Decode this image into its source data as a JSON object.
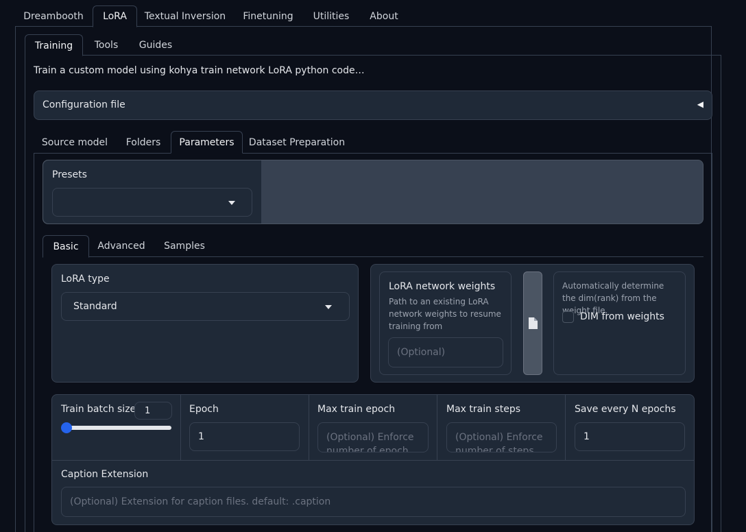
{
  "top_tabs": [
    "Dreambooth",
    "LoRA",
    "Textual Inversion",
    "Finetuning",
    "Utilities",
    "About"
  ],
  "sub_tabs": [
    "Training",
    "Tools",
    "Guides"
  ],
  "description": "Train a custom model using kohya train network LoRA python code…",
  "config_accordion": {
    "label": "Configuration file",
    "arrow": "◀"
  },
  "section_tabs": [
    "Source model",
    "Folders",
    "Parameters",
    "Dataset Preparation"
  ],
  "presets": {
    "label": "Presets",
    "value": ""
  },
  "param_tabs": [
    "Basic",
    "Advanced",
    "Samples"
  ],
  "lora_type": {
    "label": "LoRA type",
    "value": "Standard"
  },
  "network_weights": {
    "label": "LoRA network weights",
    "info": "Path to an existing LoRA network weights to resume training from",
    "placeholder": "(Optional)",
    "file_icon": "file-icon"
  },
  "dim_from_weights": {
    "info": "Automatically determine the dim(rank) from the weight file.",
    "label": "DIM from weights",
    "checked": false
  },
  "train_batch_size": {
    "label": "Train batch size",
    "value": "1",
    "slider_fraction": 0.0
  },
  "epoch": {
    "label": "Epoch",
    "value": "1"
  },
  "max_train_epoch": {
    "label": "Max train epoch",
    "placeholder": "(Optional) Enforce number of epoch"
  },
  "max_train_steps": {
    "label": "Max train steps",
    "placeholder": "(Optional) Enforce number of steps"
  },
  "save_every_n_epochs": {
    "label": "Save every N epochs",
    "value": "1"
  },
  "caption_extension": {
    "label": "Caption Extension",
    "placeholder": "(Optional) Extension for caption files. default: .caption"
  },
  "colors": {
    "accent": "#2563eb",
    "panel": "#1f2937",
    "border": "#374151",
    "background": "#0b0f19"
  }
}
